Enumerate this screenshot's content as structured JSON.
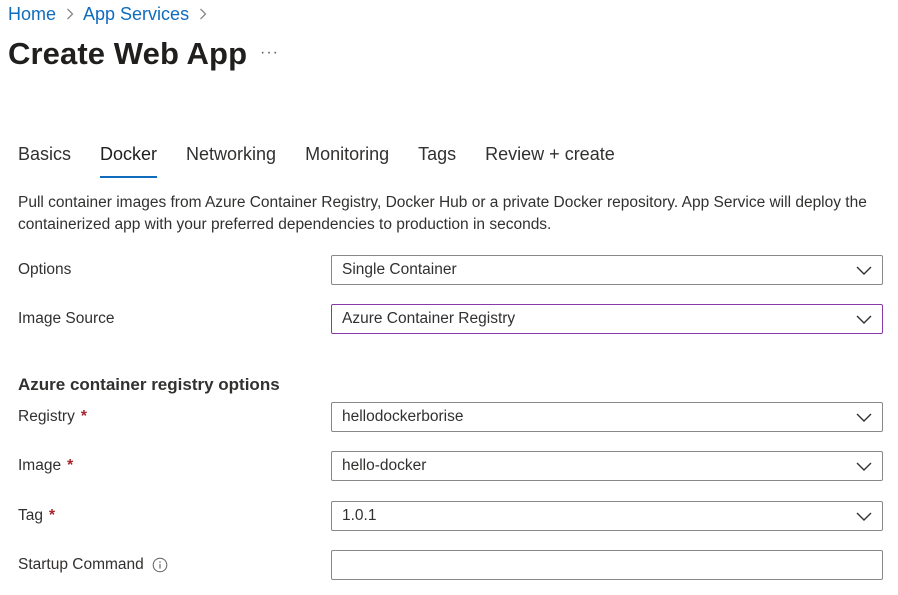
{
  "breadcrumb": {
    "items": [
      "Home",
      "App Services"
    ]
  },
  "page": {
    "title": "Create Web App",
    "more_label": "···"
  },
  "tabs": [
    {
      "label": "Basics"
    },
    {
      "label": "Docker"
    },
    {
      "label": "Networking"
    },
    {
      "label": "Monitoring"
    },
    {
      "label": "Tags"
    },
    {
      "label": "Review + create"
    }
  ],
  "active_tab": "Docker",
  "description": "Pull container images from Azure Container Registry, Docker Hub or a private Docker repository. App Service will deploy the containerized app with your preferred dependencies to production in seconds.",
  "form": {
    "options": {
      "label": "Options",
      "value": "Single Container"
    },
    "image_source": {
      "label": "Image Source",
      "value": "Azure Container Registry"
    },
    "section_title": "Azure container registry options",
    "registry": {
      "label": "Registry",
      "required_mark": "*",
      "value": "hellodockerborise"
    },
    "image": {
      "label": "Image",
      "required_mark": "*",
      "value": "hello-docker"
    },
    "tag": {
      "label": "Tag",
      "required_mark": "*",
      "value": "1.0.1"
    },
    "startup_command": {
      "label": "Startup Command",
      "value": "",
      "info_icon": "info-icon"
    }
  },
  "colors": {
    "link": "#0f6cbd",
    "tab_underline": "#0f6cbd",
    "required": "#a4262c",
    "focus_border": "#8a3aa8"
  },
  "icons": {
    "breadcrumb_separator": "chevron-right-icon",
    "dropdown": "chevron-down-icon"
  }
}
